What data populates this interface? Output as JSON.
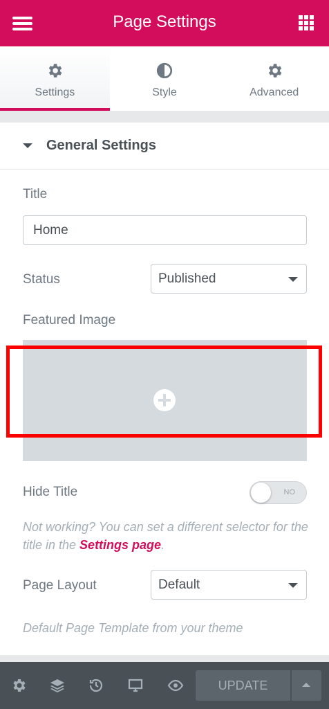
{
  "header": {
    "title": "Page Settings"
  },
  "tabs": [
    {
      "label": "Settings",
      "icon": "gear-icon",
      "active": true
    },
    {
      "label": "Style",
      "icon": "half-circle-icon",
      "active": false
    },
    {
      "label": "Advanced",
      "icon": "gear-icon",
      "active": false
    }
  ],
  "section": {
    "title": "General Settings"
  },
  "fields": {
    "title_label": "Title",
    "title_value": "Home",
    "status_label": "Status",
    "status_value": "Published",
    "featured_label": "Featured Image",
    "hide_title_label": "Hide Title",
    "hide_title_toggle": "NO",
    "hide_title_note_prefix": "Not working? You can set a different selector for the title in the ",
    "hide_title_note_link": "Settings page",
    "hide_title_note_suffix": ".",
    "layout_label": "Page Layout",
    "layout_value": "Default",
    "layout_description": "Default Page Template from your theme"
  },
  "footer": {
    "update_label": "UPDATE"
  },
  "colors": {
    "accent": "#d30c5c",
    "footer": "#495157",
    "highlight": "#ff0000"
  }
}
